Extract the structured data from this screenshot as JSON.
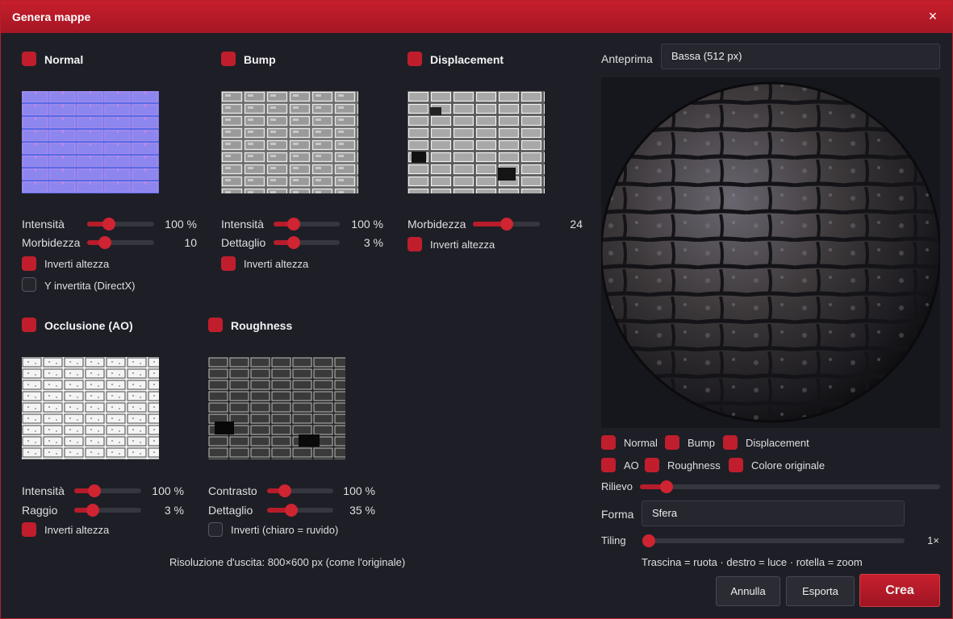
{
  "window": {
    "title": "Genera mappe",
    "close": "×"
  },
  "normal": {
    "title": "Normal",
    "intensity_label": "Intensità",
    "intensity_value": "100 %",
    "intensity_level": 0.33,
    "smooth_label": "Morbidezza",
    "smooth_value": "10",
    "smooth_level": 0.27,
    "invert_label": "Inverti altezza",
    "directx_label": "Y invertita (DirectX)"
  },
  "bump": {
    "title": "Bump",
    "intensity_label": "Intensità",
    "intensity_value": "100 %",
    "intensity_level": 0.3,
    "detail_label": "Dettaglio",
    "detail_value": "3 %",
    "detail_level": 0.3,
    "invert_label": "Inverti altezza"
  },
  "displacement": {
    "title": "Displacement",
    "smooth_label": "Morbidezza",
    "smooth_value": "24",
    "smooth_level": 0.5,
    "invert_label": "Inverti altezza"
  },
  "ao": {
    "title": "Occlusione (AO)",
    "intensity_label": "Intensità",
    "intensity_value": "100 %",
    "intensity_level": 0.3,
    "radius_label": "Raggio",
    "radius_value": "3 %",
    "radius_level": 0.28,
    "invert_label": "Inverti altezza"
  },
  "roughness": {
    "title": "Roughness",
    "contrast_label": "Contrasto",
    "contrast_value": "100 %",
    "contrast_level": 0.27,
    "detail_label": "Dettaglio",
    "detail_value": "35 %",
    "detail_level": 0.37,
    "invert_label": "Inverti (chiaro = ruvido)"
  },
  "output": {
    "text": "Risoluzione d'uscita: 800×600 px (come l'originale)"
  },
  "preview": {
    "label": "Anteprima",
    "quality_value": "Bassa (512 px)",
    "toggles": [
      "Normal",
      "Bump",
      "Displacement",
      "AO",
      "Roughness",
      "Colore originale"
    ],
    "relief_label": "Rilievo",
    "relief_level": 0.09,
    "shape_label": "Forma",
    "shape_value": "Sfera",
    "tiling_label": "Tiling",
    "tiling_value": "1×",
    "tiling_level": 0.0,
    "hint": "Trascina = ruota · destro = luce · rotella = zoom"
  },
  "buttons": {
    "cancel": "Annulla",
    "export": "Esporta",
    "create": "Crea"
  },
  "colors": {
    "accent": "#c01e2d",
    "background": "#1e1f26",
    "titlebar": "#b81a28"
  }
}
